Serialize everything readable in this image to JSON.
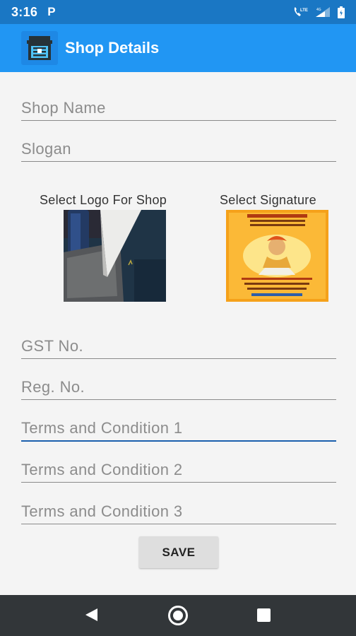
{
  "status_bar": {
    "time": "3:16",
    "notification_letter": "P",
    "network": "LTE"
  },
  "app_bar": {
    "title": "Shop Details",
    "icon": "shop-icon"
  },
  "form": {
    "shop_name_placeholder": "Shop Name",
    "slogan_placeholder": "Slogan",
    "logo_label": "Select Logo For Shop",
    "signature_label": "Select Signature",
    "gst_placeholder": "GST No.",
    "reg_placeholder": "Reg. No.",
    "terms1_placeholder": "Terms and Condition 1",
    "terms2_placeholder": "Terms and Condition 2",
    "terms3_placeholder": "Terms and Condition 3",
    "save_label": "SAVE"
  },
  "nav_bar": {
    "back_icon": "back-triangle-icon",
    "home_icon": "home-circle-icon",
    "recents_icon": "recents-square-icon"
  },
  "colors": {
    "status_bar": "#1a77c4",
    "app_bar": "#2196f3",
    "active_underline": "#1b5fad",
    "nav_bar": "#323639"
  }
}
